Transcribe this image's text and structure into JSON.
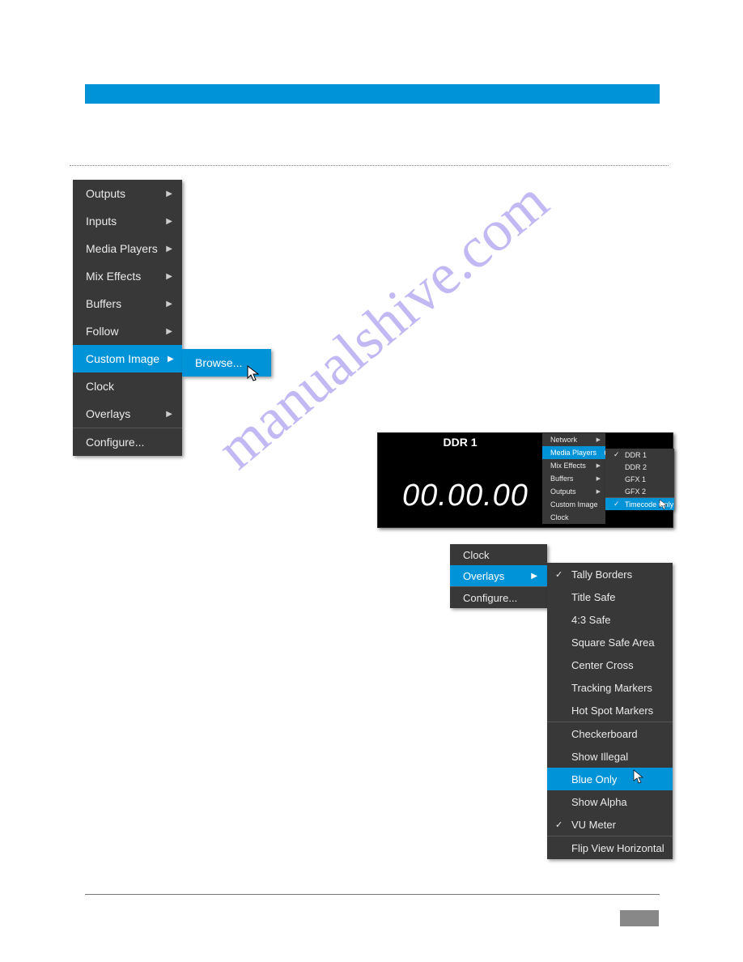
{
  "watermark": "manualshive.com",
  "fig1": {
    "items": [
      {
        "label": "Outputs",
        "arrow": true
      },
      {
        "label": "Inputs",
        "arrow": true
      },
      {
        "label": "Media Players",
        "arrow": true
      },
      {
        "label": "Mix Effects",
        "arrow": true
      },
      {
        "label": "Buffers",
        "arrow": true
      },
      {
        "label": "Follow",
        "arrow": true
      },
      {
        "label": "Custom Image",
        "arrow": true,
        "highlight": true
      },
      {
        "label": "Clock",
        "arrow": false
      },
      {
        "label": "Overlays",
        "arrow": true
      },
      {
        "label": "Configure...",
        "arrow": false
      }
    ],
    "submenu": {
      "label": "Browse..."
    }
  },
  "fig2": {
    "title": "DDR 1",
    "timecode": "00.00.00",
    "menu": [
      {
        "label": "Network",
        "arrow": true
      },
      {
        "label": "Media Players",
        "arrow": true,
        "highlight": true
      },
      {
        "label": "Mix Effects",
        "arrow": true
      },
      {
        "label": "Buffers",
        "arrow": true
      },
      {
        "label": "Outputs",
        "arrow": true
      },
      {
        "label": "Custom Image",
        "arrow": true
      },
      {
        "label": "Clock",
        "arrow": false
      }
    ],
    "submenu": [
      {
        "label": "DDR 1",
        "checked": true
      },
      {
        "label": "DDR 2",
        "checked": false
      },
      {
        "label": "GFX 1",
        "checked": false
      },
      {
        "label": "GFX 2",
        "checked": false
      },
      {
        "label": "Timecode Only",
        "checked": true,
        "highlight": true
      }
    ]
  },
  "fig3": {
    "menu": [
      {
        "label": "Clock",
        "arrow": false
      },
      {
        "label": "Overlays",
        "arrow": true,
        "highlight": true
      },
      {
        "label": "Configure...",
        "arrow": false
      }
    ],
    "submenu": [
      {
        "label": "Tally Borders",
        "checked": true,
        "sep": false
      },
      {
        "label": "Title Safe",
        "checked": false
      },
      {
        "label": "4:3 Safe",
        "checked": false
      },
      {
        "label": "Square Safe Area",
        "checked": false
      },
      {
        "label": "Center Cross",
        "checked": false
      },
      {
        "label": "Tracking Markers",
        "checked": false
      },
      {
        "label": "Hot Spot Markers",
        "checked": false,
        "sep": true
      },
      {
        "label": "Checkerboard",
        "checked": false
      },
      {
        "label": "Show Illegal",
        "checked": false
      },
      {
        "label": "Blue Only",
        "checked": false,
        "highlight": true
      },
      {
        "label": "Show Alpha",
        "checked": false
      },
      {
        "label": "VU Meter",
        "checked": true,
        "sep": true
      },
      {
        "label": "Flip View Horizontal",
        "checked": false
      }
    ]
  }
}
